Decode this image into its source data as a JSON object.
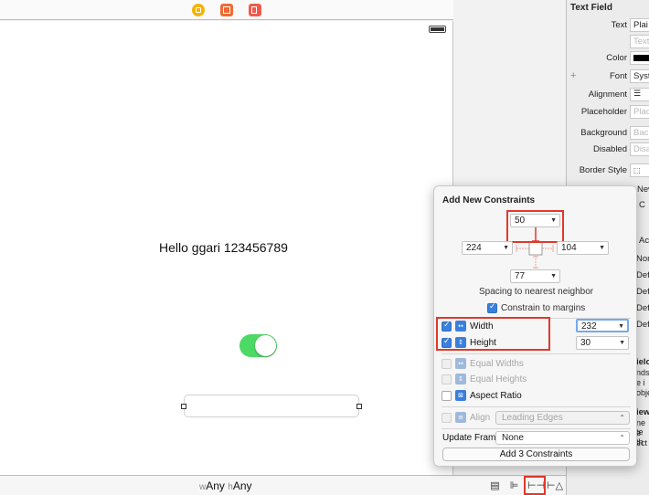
{
  "scene": {
    "label_text": "Hello ggari 123456789",
    "switch_on": true,
    "size_class": {
      "w_prefix": "w",
      "w_value": "Any",
      "h_prefix": "h",
      "h_value": "Any"
    }
  },
  "toolbar_icons": [
    "view-controller-icon",
    "first-responder-icon",
    "exit-icon"
  ],
  "bottom_icons": [
    "stack-icon",
    "align-icon",
    "pin-icon",
    "resolve-icon"
  ],
  "inspector": {
    "title": "Text Field",
    "rows": [
      {
        "label": "Text",
        "value": "Plai",
        "placeholder": false
      },
      {
        "label": "",
        "value": "Text",
        "placeholder": true
      },
      {
        "label": "Color",
        "value": "",
        "placeholder": false
      },
      {
        "label": "Font",
        "value": "Syst",
        "placeholder": false
      },
      {
        "label": "Alignment",
        "value": "",
        "placeholder": false
      },
      {
        "label": "Placeholder",
        "value": "Plac",
        "placeholder": true
      },
      {
        "label": "Background",
        "value": "Back",
        "placeholder": true
      },
      {
        "label": "Disabled",
        "value": "Disa",
        "placeholder": true
      },
      {
        "label": "Border Style",
        "value": "",
        "placeholder": false
      }
    ],
    "partial_right": [
      "New",
      "C",
      "Ac",
      "Non",
      "Def",
      "Def",
      "Def",
      "Def",
      "ielo",
      "nds",
      "e i",
      "obje",
      "iew",
      "ne te",
      "e th",
      "ect"
    ]
  },
  "popover": {
    "title": "Add New Constraints",
    "top_value": "50",
    "left_value": "224",
    "right_value": "104",
    "bottom_value": "77",
    "spacing_text": "Spacing to nearest neighbor",
    "constrain_margins": {
      "label": "Constrain to margins",
      "checked": true
    },
    "width": {
      "label": "Width",
      "checked": true,
      "value": "232"
    },
    "height": {
      "label": "Height",
      "checked": true,
      "value": "30"
    },
    "equal_widths": {
      "label": "Equal Widths",
      "enabled": false
    },
    "equal_heights": {
      "label": "Equal Heights",
      "enabled": false
    },
    "aspect_ratio": {
      "label": "Aspect Ratio",
      "checked": false
    },
    "align": {
      "label": "Align",
      "value": "Leading Edges",
      "enabled": false
    },
    "update_frames": {
      "label": "Update Frames",
      "value": "None"
    },
    "add_button": "Add 3 Constraints"
  },
  "colors": {
    "highlight": "#e0392b",
    "accent": "#3a7fdc",
    "switch_on": "#4cd964"
  }
}
